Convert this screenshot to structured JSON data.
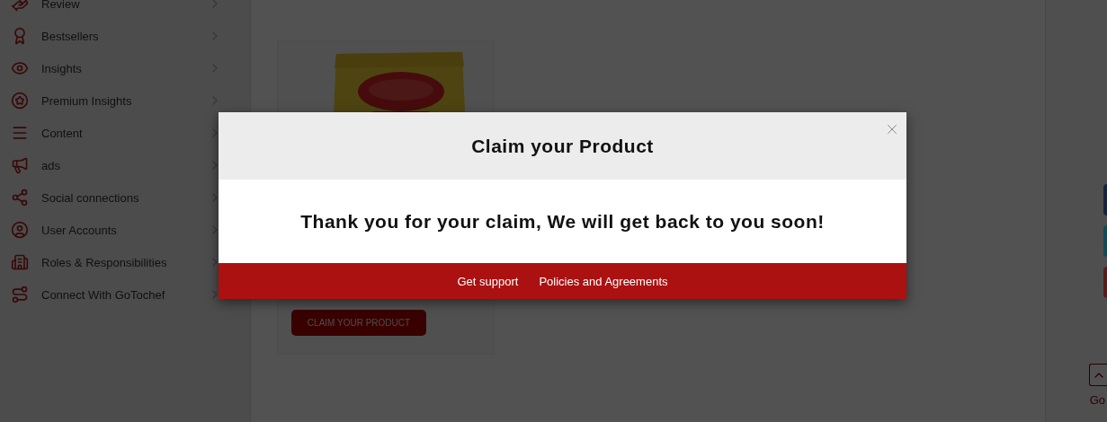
{
  "sidebar": {
    "items": [
      {
        "label": "Review"
      },
      {
        "label": "Bestsellers"
      },
      {
        "label": "Insights"
      },
      {
        "label": "Premium Insights"
      },
      {
        "label": "Content"
      },
      {
        "label": "ads"
      },
      {
        "label": "Social connections"
      },
      {
        "label": "User Accounts"
      },
      {
        "label": "Roles & Responsibilities"
      },
      {
        "label": "Connect With GoTochef"
      }
    ]
  },
  "product_card": {
    "button": "CLAIM YOUR PRODUCT"
  },
  "side_tabs": [
    {
      "color": "#172544"
    },
    {
      "color": "#0b4f5a"
    },
    {
      "color": "#5e1a1a"
    }
  ],
  "go_up": {
    "label": "Go"
  },
  "modal": {
    "title": "Claim your Product",
    "message": "Thank you for your claim, We will get back to you soon!",
    "footer_links": [
      "Get support",
      "Policies and Agreements"
    ]
  }
}
